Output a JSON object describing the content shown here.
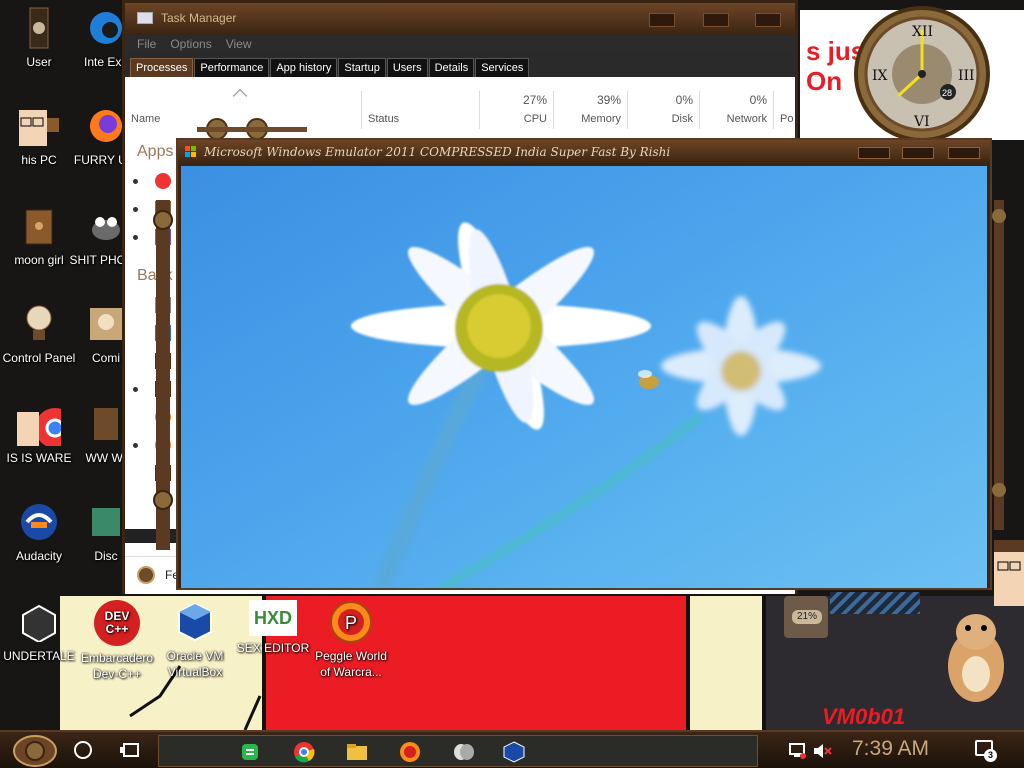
{
  "desktop": {
    "icons": [
      {
        "label": "User"
      },
      {
        "label": "Inte Exp"
      },
      {
        "label": "his PC"
      },
      {
        "label": "FURRY UW"
      },
      {
        "label": "moon girl"
      },
      {
        "label": "SHIT PHOTO"
      },
      {
        "label": "Control Panel"
      },
      {
        "label": "Comi"
      },
      {
        "label": "IS IS WARE"
      },
      {
        "label": "WW Wr"
      },
      {
        "label": "Audacity"
      },
      {
        "label": "Disc"
      },
      {
        "label": "UNDERTALE"
      },
      {
        "label": "Embarcadero Dev-C++"
      },
      {
        "label": "Oracle VM VirtualBox"
      },
      {
        "label": "SEX EDITOR"
      },
      {
        "label": "Peggle World of Warcra..."
      }
    ],
    "wallpaper_text": "VM0b01",
    "gauge_text": "21%",
    "wallpaper_red_text": "s jus e On",
    "dev_icon_text": "DEV C++",
    "hxd_text": "HXD"
  },
  "clock": {
    "badge": "28",
    "numerals": [
      "XII",
      "III",
      "VI",
      "IX"
    ]
  },
  "task_manager": {
    "title": "Task Manager",
    "menu": [
      "File",
      "Options",
      "View"
    ],
    "tabs": [
      "Processes",
      "Performance",
      "App history",
      "Startup",
      "Users",
      "Details",
      "Services"
    ],
    "active_tab": "Processes",
    "columns": {
      "name": "Name",
      "status": "Status",
      "cpu_pct": "27%",
      "cpu": "CPU",
      "memory_pct": "39%",
      "memory": "Memory",
      "disk_pct": "0%",
      "disk": "Disk",
      "network_pct": "0%",
      "network": "Network",
      "power": "Po"
    },
    "sections": {
      "apps": "Apps",
      "background": "Back"
    },
    "footer": "Fe"
  },
  "emulator": {
    "title": "Microsoft Windows Emulator 2011 COMPRESSED India Super Fast By Rishi"
  },
  "taskbar": {
    "time": "7:39 AM",
    "notification_count": "3",
    "pinned": [
      "notes-app",
      "chrome",
      "file-explorer",
      "peggle",
      "masks-app",
      "virtualbox"
    ]
  },
  "colors": {
    "frame_brown": "#5a3a22",
    "emulator_sky": "#4aa3ec",
    "time_text": "#c9a87a",
    "wallpaper_red": "#ec1c24",
    "wallpaper_cream": "#f7f1c7"
  }
}
